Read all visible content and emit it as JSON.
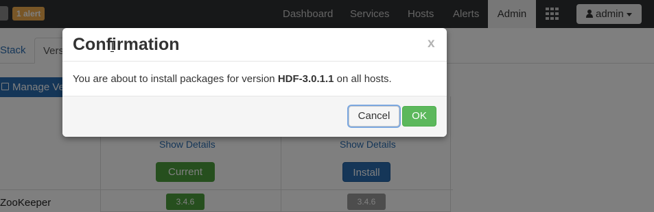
{
  "navbar": {
    "alert_badge": "1 alert",
    "items": [
      "Dashboard",
      "Services",
      "Hosts",
      "Alerts",
      "Admin"
    ],
    "user_label": "admin"
  },
  "page": {
    "subtabs": [
      "Stack",
      "Versi"
    ],
    "manage_button": "Manage Ve",
    "columns": [
      {
        "show_details": "Show Details",
        "action": "Current",
        "version": "3.4.6"
      },
      {
        "show_details": "Show Details",
        "action": "Install",
        "version": "3.4.6"
      }
    ],
    "component_name": "ZooKeeper"
  },
  "modal": {
    "title": "Confirmation",
    "close": "x",
    "body_prefix": "You are about to install packages for version ",
    "body_version": "HDF-3.0.1.1",
    "body_suffix": " on all hosts.",
    "cancel_label": "Cancel",
    "ok_label": "OK"
  },
  "colors": {
    "navbar": "#2f3033",
    "alert_badge": "#f0ad4e",
    "link": "#2a6db1",
    "ok_button": "#5cb85c",
    "current_button": "#4d9f3c",
    "install_button": "#2a6db1"
  }
}
